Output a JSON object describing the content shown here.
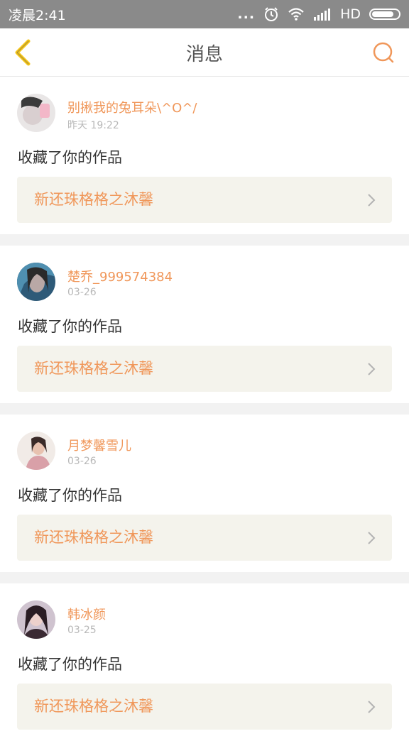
{
  "status_bar": {
    "time": "凌晨2:41",
    "dots": "...",
    "network": "HD",
    "icons": [
      "alarm-icon",
      "wifi-icon",
      "signal-icon",
      "battery-icon"
    ]
  },
  "nav": {
    "title": "消息",
    "back_icon": "chevron-left-icon",
    "search_icon": "search-icon",
    "accent_color": "#f0975a",
    "back_color": "#f5c518"
  },
  "messages": [
    {
      "username": "别揪我的兔耳朵\\^O^/",
      "time": "昨天 19:22",
      "action": "收藏了你的作品",
      "work_title": "新还珠格格之沐馨"
    },
    {
      "username": "楚乔_999574384",
      "time": "03-26",
      "action": "收藏了你的作品",
      "work_title": "新还珠格格之沐馨"
    },
    {
      "username": "月梦馨雪儿",
      "time": "03-26",
      "action": "收藏了你的作品",
      "work_title": "新还珠格格之沐馨"
    },
    {
      "username": "韩冰颜",
      "time": "03-25",
      "action": "收藏了你的作品",
      "work_title": "新还珠格格之沐馨"
    }
  ]
}
